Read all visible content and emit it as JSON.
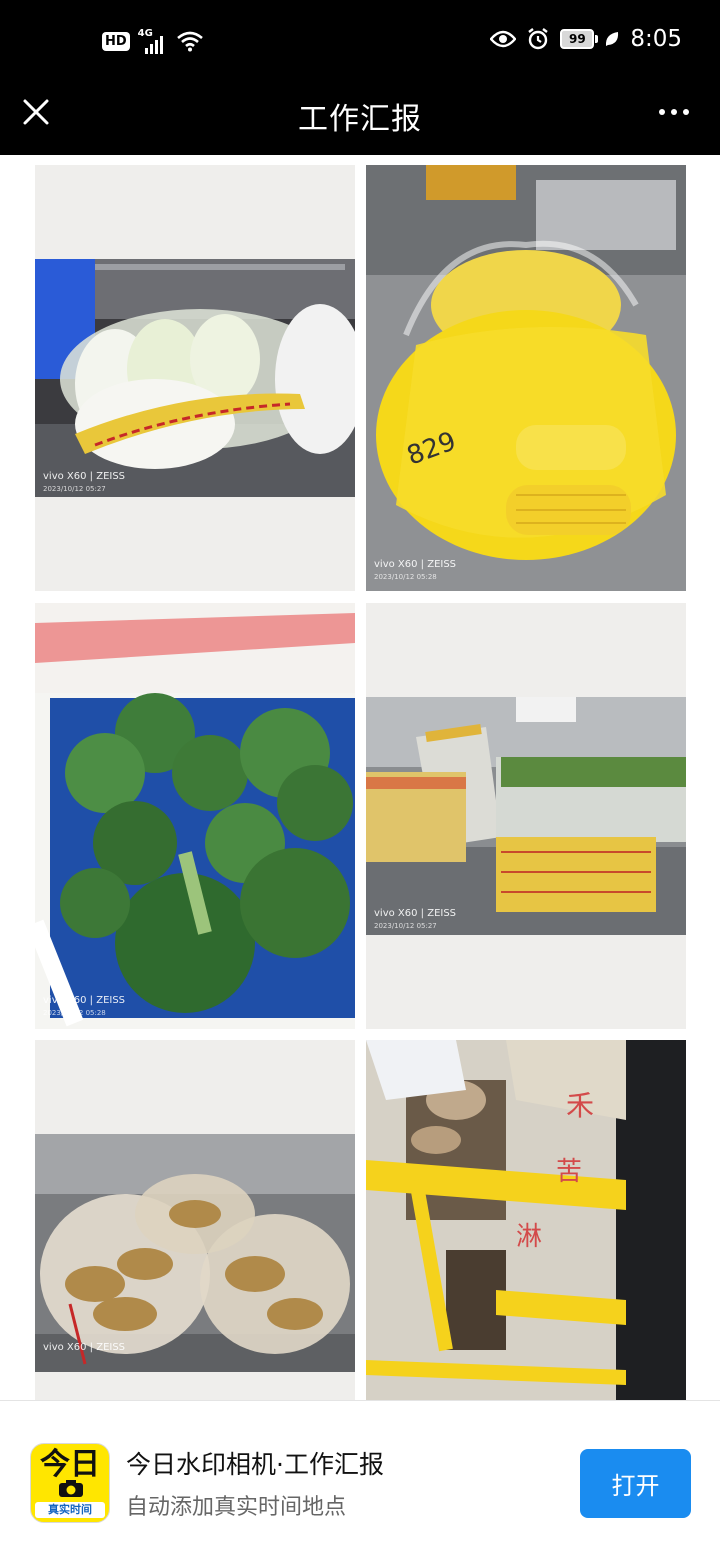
{
  "status_bar": {
    "hd": "HD",
    "network": "4G",
    "battery": "99",
    "time": "8:05",
    "icons": [
      "signal-icon",
      "wifi-icon",
      "eye-icon",
      "alarm-icon",
      "battery-icon",
      "leaf-icon"
    ]
  },
  "nav": {
    "title": "工作汇报",
    "close_icon": "close-icon",
    "more_icon": "more-icon"
  },
  "photos": [
    {
      "subject": "napa cabbage",
      "watermark_brand": "vivo X60 | ZEISS",
      "watermark_date": "2023/10/12 05:27"
    },
    {
      "subject": "corn",
      "watermark_brand": "vivo X60 | ZEISS",
      "watermark_date": "2023/10/12 05:28"
    },
    {
      "subject": "broccoli",
      "watermark_brand": "vivo X60 | ZEISS",
      "watermark_date": "2023/10/12 05:28"
    },
    {
      "subject": "leafy greens",
      "watermark_brand": "vivo X60 | ZEISS",
      "watermark_date": "2023/10/12 05:27"
    },
    {
      "subject": "ginger",
      "watermark_brand": "vivo X60 | ZEISS",
      "watermark_date": ""
    },
    {
      "subject": "yam box",
      "watermark_brand": "",
      "watermark_date": ""
    }
  ],
  "banner": {
    "icon_big_text": "今日",
    "icon_strip_text": "真实时间",
    "app_name": "今日水印相机·工作汇报",
    "app_desc": "自动添加真实时间地点",
    "open_label": "打开"
  },
  "colors": {
    "bar_bg": "#000000",
    "accent": "#1a8cf0",
    "icon_yellow": "#ffe600"
  }
}
